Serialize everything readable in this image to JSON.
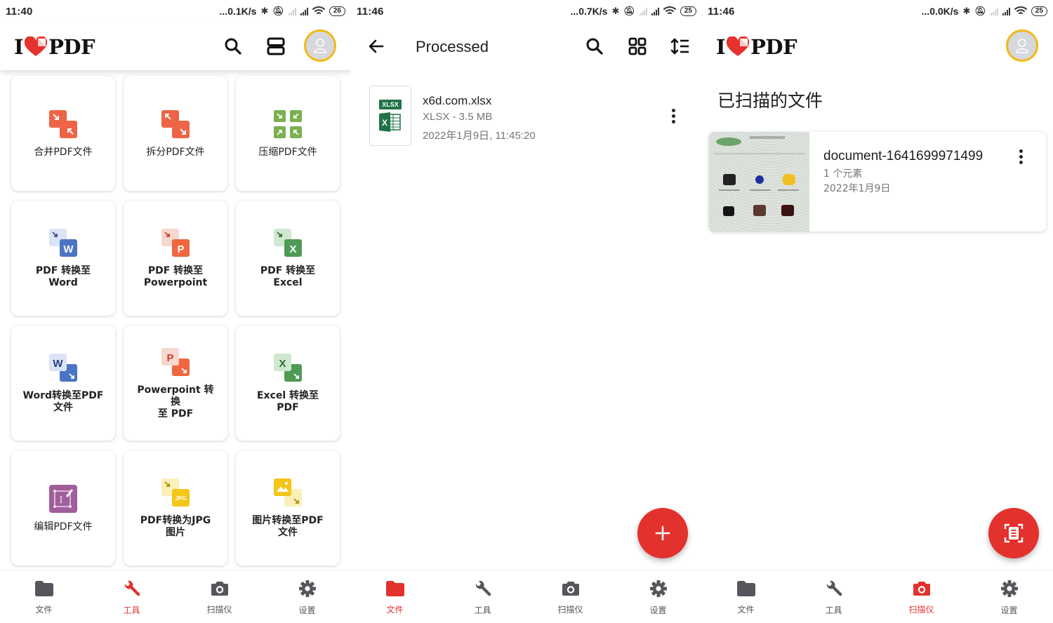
{
  "colors": {
    "accent_red": "#e3312d",
    "avatar_ring": "#f2b918",
    "icon_gray": "#55565c",
    "text_secondary": "#757575"
  },
  "screens": [
    {
      "id": "tools",
      "status": {
        "time": "11:40",
        "net_speed": "...0.1K/s",
        "battery": "26"
      },
      "header": {
        "logo_left": "I",
        "logo_right": "PDF",
        "search_icon": "search-icon",
        "layout_icon": "view-list-icon",
        "avatar_icon": "user-avatar-icon"
      },
      "tools": [
        {
          "label": "合并PDF文件",
          "icon": "merge-pdf-icon",
          "color": "#ee6446",
          "bold": false
        },
        {
          "label": "拆分PDF文件",
          "icon": "split-pdf-icon",
          "color": "#ee6446",
          "bold": false
        },
        {
          "label": "压缩PDF文件",
          "icon": "compress-pdf-icon",
          "color": "#7ab150",
          "bold": false
        },
        {
          "label": "PDF 转换至\nWord",
          "icon": "pdf-to-word-icon",
          "color": "#4b74c4",
          "bold": true
        },
        {
          "label": "PDF 转换至\nPowerpoint",
          "icon": "pdf-to-powerpoint-icon",
          "color": "#f0663f",
          "bold": true
        },
        {
          "label": "PDF 转换至\nExcel",
          "icon": "pdf-to-excel-icon",
          "color": "#4f9a55",
          "bold": true
        },
        {
          "label": "Word转换至PDF\n文件",
          "icon": "word-to-pdf-icon",
          "color": "#4b74c4",
          "bold": true
        },
        {
          "label": "Powerpoint 转换\n至 PDF",
          "icon": "powerpoint-to-pdf-icon",
          "color": "#f0663f",
          "bold": true
        },
        {
          "label": "Excel 转换至\nPDF",
          "icon": "excel-to-pdf-icon",
          "color": "#4f9a55",
          "bold": true
        },
        {
          "label": "编辑PDF文件",
          "icon": "edit-pdf-icon",
          "color": "#a05e9a",
          "bold": false
        },
        {
          "label": "PDF转换为JPG\n图片",
          "icon": "pdf-to-jpg-icon",
          "color": "#f5c518",
          "bold": true
        },
        {
          "label": "图片转换至PDF\n文件",
          "icon": "image-to-pdf-icon",
          "color": "#f5c518",
          "bold": true
        }
      ],
      "active_tab": 1
    },
    {
      "id": "processed",
      "status": {
        "time": "11:46",
        "net_speed": "...0.7K/s",
        "battery": "25"
      },
      "header": {
        "title": "Processed",
        "back_icon": "arrow-back-icon",
        "search_icon": "search-icon",
        "grid_icon": "grid-view-icon",
        "sort_icon": "sort-icon"
      },
      "files": [
        {
          "badge": "XLSX",
          "name": "x6d.com.xlsx",
          "type_size": "XLSX - 3.5 MB",
          "date": "2022年1月9日, 11:45:20"
        }
      ],
      "fab_icon": "add-icon",
      "fab_label": "+",
      "active_tab": 0
    },
    {
      "id": "scanner",
      "status": {
        "time": "11:46",
        "net_speed": "...0.0K/s",
        "battery": "25"
      },
      "header": {
        "logo_left": "I",
        "logo_right": "PDF",
        "avatar_icon": "user-avatar-icon"
      },
      "section_title": "已扫描的文件",
      "scans": [
        {
          "name": "document-1641699971499",
          "count": "1 个元素",
          "date": "2022年1月9日"
        }
      ],
      "fab_icon": "document-scan-icon",
      "active_tab": 2
    }
  ],
  "nav": [
    {
      "label": "文件",
      "icon": "folder-icon"
    },
    {
      "label": "工具",
      "icon": "wrench-icon"
    },
    {
      "label": "扫描仪",
      "icon": "camera-icon"
    },
    {
      "label": "设置",
      "icon": "gear-icon"
    }
  ]
}
